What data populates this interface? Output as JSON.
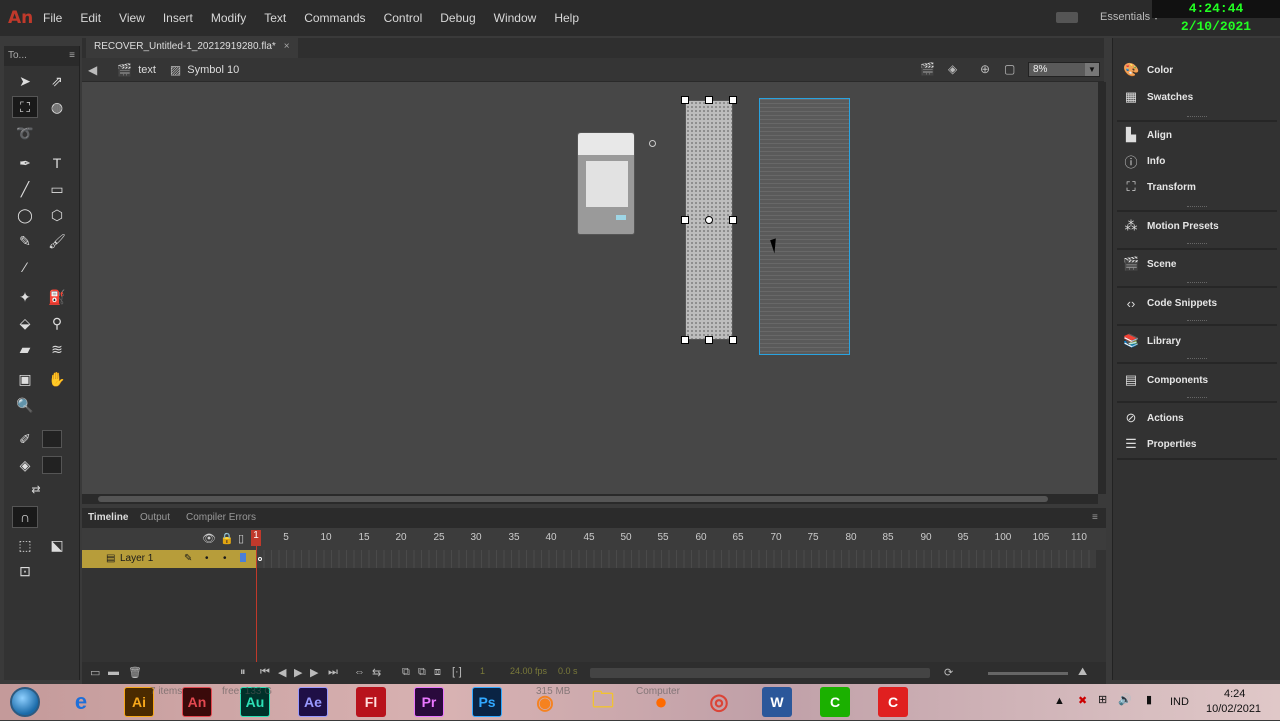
{
  "app": {
    "logo": "An",
    "workspace": "Essentials ▾",
    "clock": "4:24:44  2/10/2021"
  },
  "menu": [
    "File",
    "Edit",
    "View",
    "Insert",
    "Modify",
    "Text",
    "Commands",
    "Control",
    "Debug",
    "Window",
    "Help"
  ],
  "toolbox": {
    "title": "To...",
    "menu_icon": "≡"
  },
  "document": {
    "tab_title": "RECOVER_Untitled-1_20212919280.fla*",
    "close": "×"
  },
  "editbar": {
    "scene": "text",
    "symbol": "Symbol 10",
    "zoom": "8%"
  },
  "timeline": {
    "tabs": [
      "Timeline",
      "Output",
      "Compiler Errors"
    ],
    "ruler": [
      "1",
      "5",
      "10",
      "15",
      "20",
      "25",
      "30",
      "35",
      "40",
      "45",
      "50",
      "55",
      "60",
      "65",
      "70",
      "75",
      "80",
      "85",
      "90",
      "95",
      "100",
      "105",
      "110"
    ],
    "layer_name": "Layer 1",
    "current_frame": "1",
    "fps": "24.00 fps",
    "elapsed": "0.0 s"
  },
  "right_panel": {
    "items": [
      "Color",
      "Swatches",
      "Align",
      "Info",
      "Transform",
      "Motion Presets",
      "Scene",
      "Code Snippets",
      "Library",
      "Components",
      "Actions",
      "Properties"
    ]
  },
  "taskbar": {
    "apps": [
      "Ai",
      "An",
      "Au",
      "Ae",
      "Fl",
      "Pr",
      "Ps"
    ],
    "tray_lang": "IND",
    "tray_time": "4:24",
    "tray_date": "10/02/2021",
    "ghost_text_1": "7 items",
    "ghost_text_2": "free: 133 G",
    "ghost_text_3": "315 MB",
    "ghost_text_4": "Computer"
  },
  "colors": {
    "accent_selection": "#29a3e0",
    "layer_row": "#b79d3a",
    "playhead": "#c0392b",
    "clock_text": "#22ff22"
  }
}
